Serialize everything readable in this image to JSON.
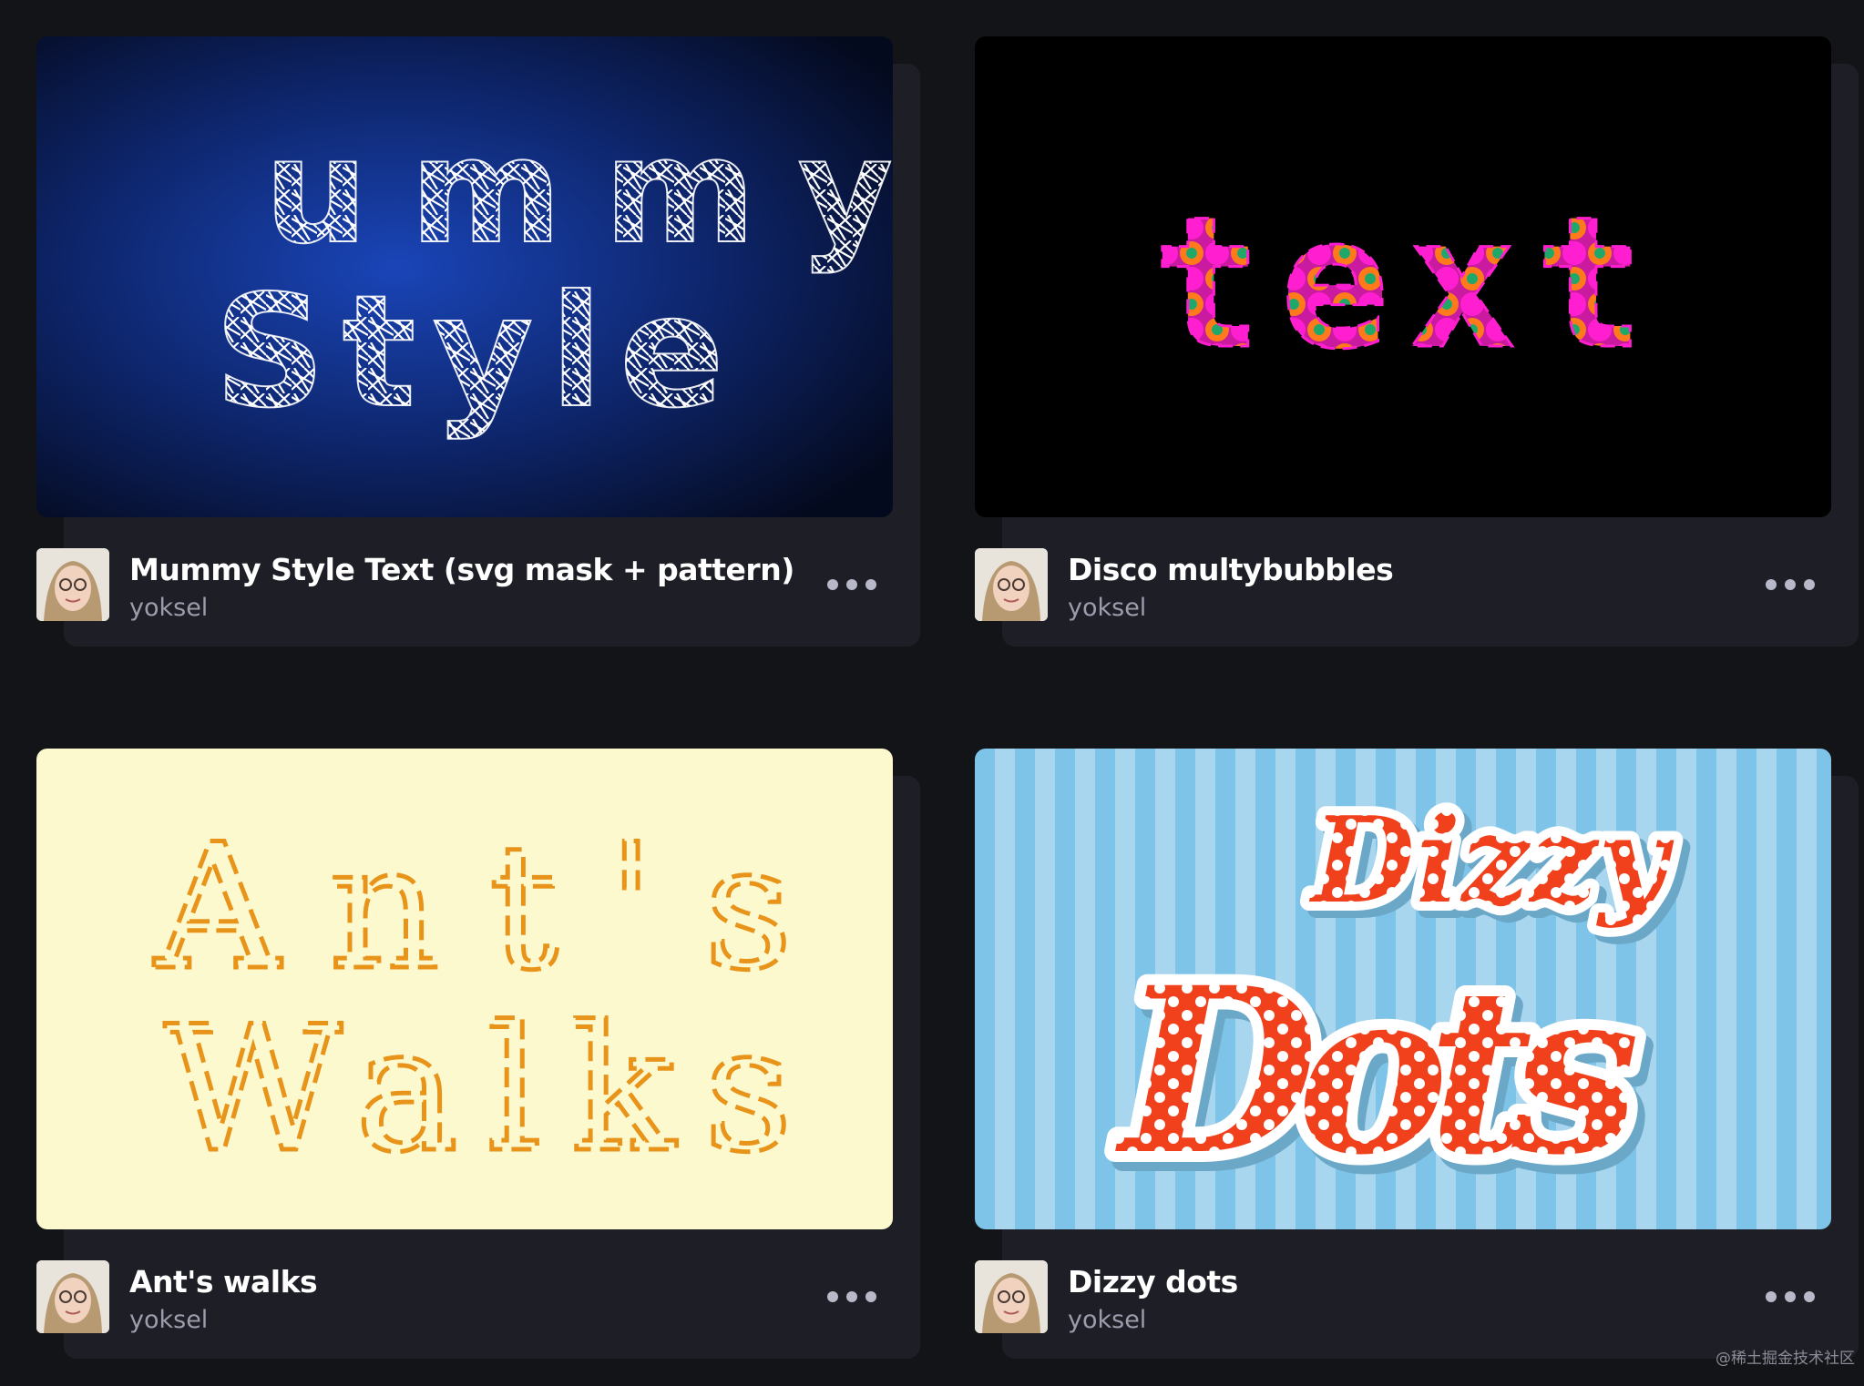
{
  "pens": [
    {
      "title": "Mummy Style Text (svg mask + pattern)",
      "author": "yoksel",
      "preview_text": [
        "ummy",
        "Style"
      ]
    },
    {
      "title": "Disco multybubbles",
      "author": "yoksel",
      "preview_text": [
        "text"
      ]
    },
    {
      "title": "Ant's walks",
      "author": "yoksel",
      "preview_text": [
        "Ant's",
        "Walks"
      ]
    },
    {
      "title": "Dizzy dots",
      "author": "yoksel",
      "preview_text": [
        "Dizzy",
        "Dots"
      ]
    }
  ],
  "watermark": "@稀土掘金技术社区",
  "colors": {
    "page_bg": "#131417",
    "card_bg": "#1e1f26",
    "title": "#ffffff",
    "author": "#9b9dad",
    "disco_magenta": "#ff1fd0",
    "disco_orange": "#ff7a1a",
    "dizzy_red": "#f0401c",
    "ants_bg": "#fdf9cf"
  },
  "icons": [
    "avatar-photo",
    "more-options-icon"
  ]
}
